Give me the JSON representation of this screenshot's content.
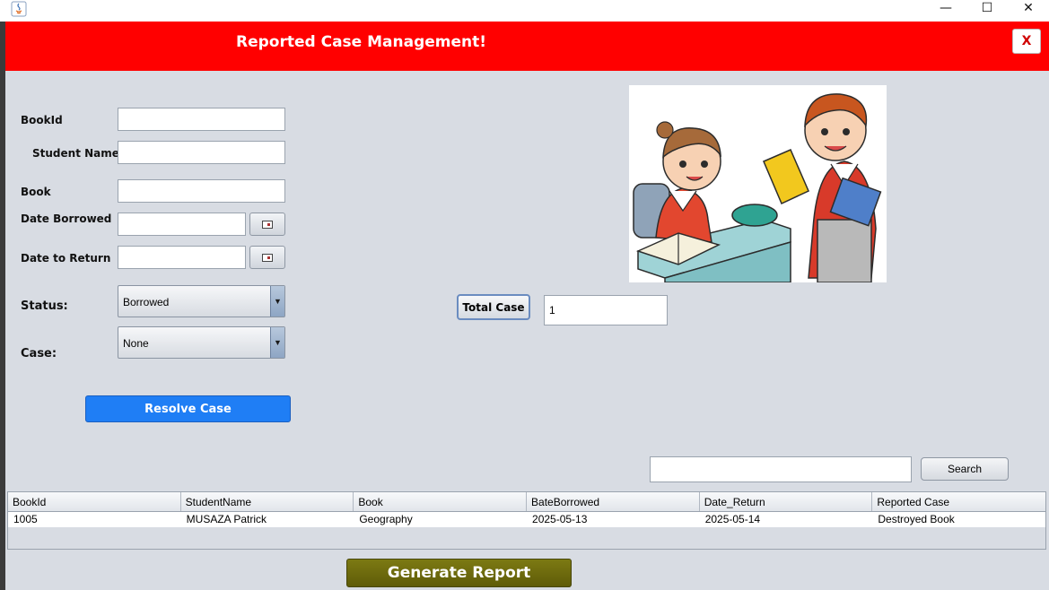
{
  "window": {
    "minimize_glyph": "—",
    "maximize_glyph": "☐",
    "close_glyph": "✕"
  },
  "header": {
    "title": "Reported Case Management!",
    "close_label": "X",
    "color": "#ff0000"
  },
  "form": {
    "book_id_label": "BookId",
    "book_id_value": "",
    "student_name_label": "Student Name",
    "student_name_value": "",
    "book_label": "Book",
    "book_value": "",
    "date_borrowed_label": "Date Borrowed",
    "date_borrowed_value": "",
    "date_to_return_label": "Date to Return",
    "date_to_return_value": "",
    "status_label": "Status:",
    "status_value": "Borrowed",
    "case_label": "Case:",
    "case_value": "None",
    "resolve_label": "Resolve Case"
  },
  "stats": {
    "total_case_label": "Total Case",
    "total_case_value": "1"
  },
  "search": {
    "value": "",
    "button_label": "Search"
  },
  "table": {
    "columns": [
      "BookId",
      "StudentName",
      "Book",
      "BateBorrowed",
      "Date_Return",
      "Reported Case"
    ],
    "rows": [
      [
        "1005",
        "MUSAZA Patrick",
        "Geography",
        "2025-05-13",
        "2025-05-14",
        "Destroyed Book"
      ]
    ]
  },
  "footer": {
    "generate_label": "Generate Report"
  },
  "colors": {
    "accent_blue": "#1f7ef5",
    "report_olive": "#6b690e"
  },
  "illustration": {
    "icon": "kids-reading-books-illustration"
  }
}
